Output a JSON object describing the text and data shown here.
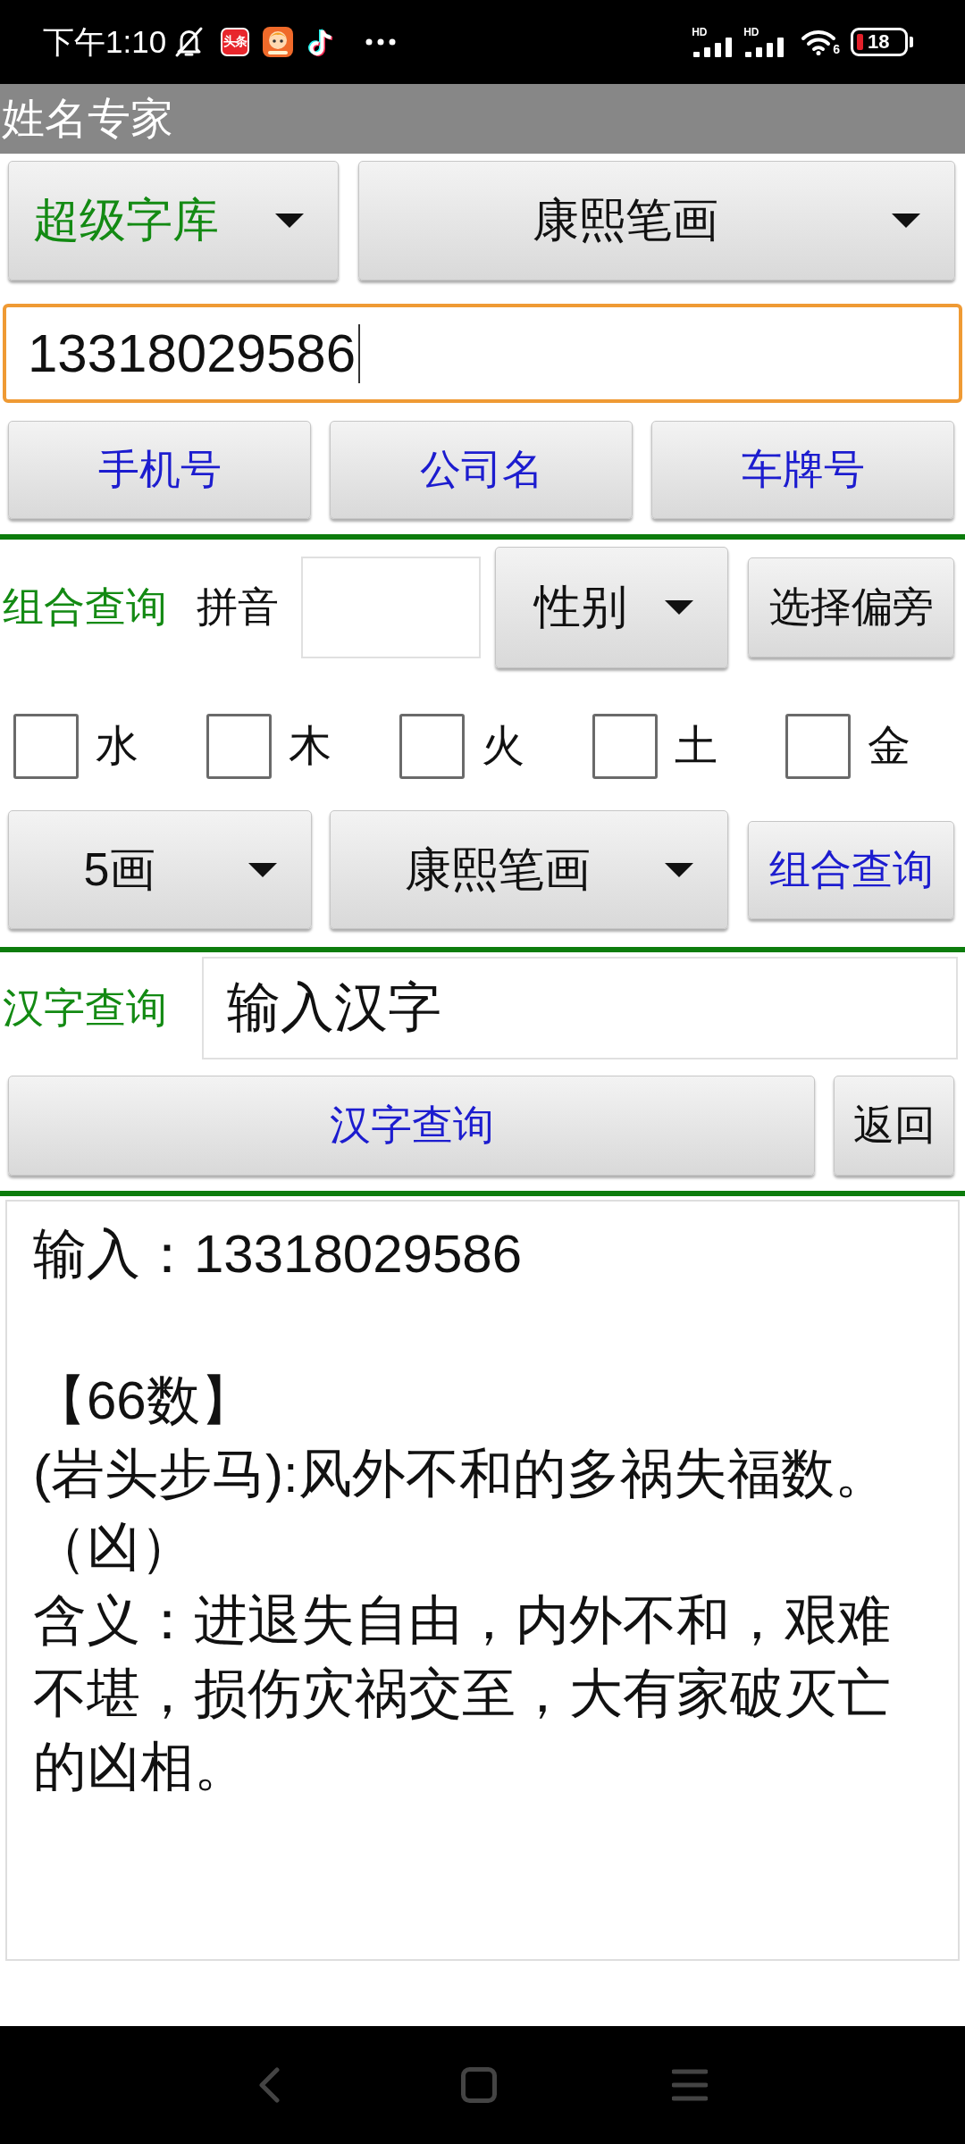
{
  "status_bar": {
    "time": "下午1:10",
    "notifications": [
      {
        "kind": "news",
        "text": "头条"
      },
      {
        "kind": "cartoon"
      },
      {
        "kind": "music"
      },
      {
        "kind": "more"
      }
    ],
    "signals": [
      {
        "label": "HD"
      },
      {
        "label": "HD"
      }
    ],
    "wifi_label": "6",
    "battery": "18"
  },
  "app_bar": {
    "title": "姓名专家"
  },
  "source_row": {
    "library": "超级字库",
    "stroke_mode": "康熙笔画"
  },
  "number_field": {
    "value": "13318029586",
    "focused": true
  },
  "type_buttons": [
    "手机号",
    "公司名",
    "车牌号"
  ],
  "combo": {
    "label": "组合查询",
    "pinyin_label": "拼音",
    "gender": "性别",
    "radical_button": "选择偏旁",
    "elements": [
      {
        "label": "水",
        "checked": false
      },
      {
        "label": "木",
        "checked": false
      },
      {
        "label": "火",
        "checked": false
      },
      {
        "label": "土",
        "checked": false
      },
      {
        "label": "金",
        "checked": false
      }
    ],
    "strokes": "5画",
    "stroke_mode": "康熙笔画",
    "query_button": "组合查询"
  },
  "hanzi": {
    "label": "汉字查询",
    "value": "输入汉字",
    "query_button": "汉字查询",
    "back_button": "返回"
  },
  "result": {
    "input_line": "输入：13318029586",
    "number_title": "【66数】",
    "verse": "(岩头步马):风外不和的多祸失福数。",
    "verdict": "（凶）",
    "meaning": "含义：进退失自由，内外不和，艰难不堪，损伤灾祸交至，大有家破灭亡的凶相。"
  }
}
